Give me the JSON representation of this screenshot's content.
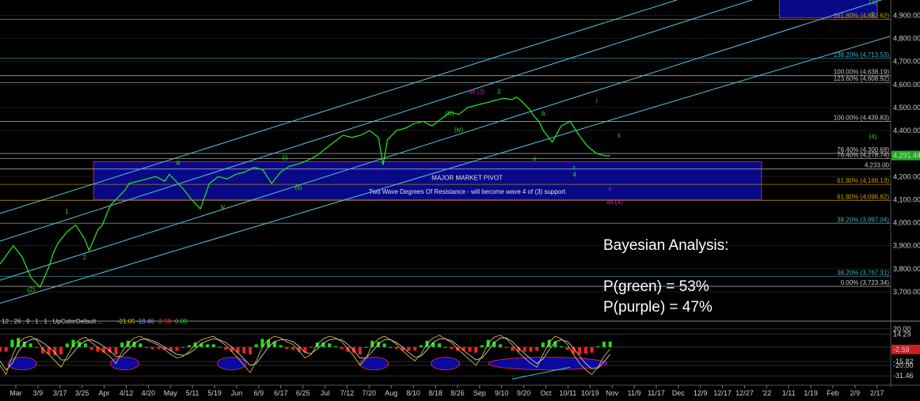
{
  "chart_data": {
    "type": "line",
    "price_axis": {
      "ylim": [
        3600,
        4960
      ],
      "ticks": [
        "4,900.00",
        "4,800.00",
        "4,700.00",
        "4,600.00",
        "4,500.00",
        "4,400.00",
        "4,300.00",
        "4,200.00",
        "4,100.00",
        "4,000.00",
        "3,900.00",
        "3,800.00",
        "3,700.00"
      ],
      "tick_values": [
        4900,
        4800,
        4700,
        4600,
        4500,
        4400,
        4300,
        4200,
        4100,
        4000,
        3900,
        3800,
        3700
      ]
    },
    "x_ticks": [
      "Mar",
      "3/9",
      "3/17",
      "3/25",
      "Apr",
      "4/12",
      "4/20",
      "May",
      "5/11",
      "5/19",
      "Jun",
      "6/9",
      "6/17",
      "6/25",
      "Jul",
      "7/12",
      "7/20",
      "Aug",
      "8/10",
      "8/18",
      "8/26",
      "Sep",
      "9/10",
      "9/20",
      "Oct",
      "10/11",
      "10/19",
      "Nov",
      "11/9",
      "11/17",
      "Dec",
      "12/9",
      "12/17",
      "12/27",
      "'22",
      "1/11",
      "1/19",
      "Feb",
      "2/9",
      "2/17"
    ],
    "price_series": {
      "color": "#22dd22",
      "x": [
        0,
        3,
        5,
        7,
        9,
        11,
        12,
        13,
        15,
        17,
        19,
        20,
        22,
        23,
        24,
        25,
        27,
        28,
        29,
        31,
        33,
        35,
        37,
        38,
        39,
        41,
        43,
        45,
        47,
        49,
        51,
        53,
        55,
        57,
        59,
        61,
        63,
        65,
        67,
        69,
        71,
        73,
        75,
        77,
        79,
        81,
        83,
        85,
        86,
        87,
        89,
        91,
        93,
        95,
        97,
        99,
        101,
        103,
        105,
        107,
        109,
        111,
        113,
        115,
        116,
        117,
        118,
        119,
        120,
        121,
        122,
        124,
        126,
        128,
        130,
        132,
        134,
        136,
        137
      ],
      "y": [
        3820,
        3900,
        3850,
        3760,
        3720,
        3810,
        3870,
        3910,
        3960,
        3990,
        3930,
        3880,
        3970,
        3990,
        4040,
        4080,
        4120,
        4140,
        4170,
        4180,
        4190,
        4200,
        4180,
        4210,
        4190,
        4150,
        4100,
        4060,
        4170,
        4200,
        4190,
        4210,
        4220,
        4240,
        4230,
        4170,
        4220,
        4245,
        4255,
        4270,
        4290,
        4320,
        4350,
        4380,
        4370,
        4380,
        4400,
        4370,
        4250,
        4360,
        4400,
        4410,
        4430,
        4440,
        4420,
        4450,
        4480,
        4470,
        4500,
        4510,
        4520,
        4530,
        4540,
        4535,
        4545,
        4530,
        4510,
        4490,
        4460,
        4440,
        4400,
        4350,
        4420,
        4440,
        4380,
        4330,
        4300,
        4290,
        4291
      ]
    },
    "last_price": "4,291.44",
    "price_levels": [
      {
        "label": "161.80% (4,882.62)",
        "value": 4882.62,
        "color": "#c8a000"
      },
      {
        "label": "138.20% (4,713.53)",
        "value": 4713.53,
        "color": "#3fb0c8"
      },
      {
        "label": "100.00% (4,638.19)",
        "value": 4638.19,
        "color": "#c8c8c8"
      },
      {
        "label": "123.60% (4,608.92)",
        "value": 4608.92,
        "color": "#c8c8c8"
      },
      {
        "label": "100.00% (4,439.83)",
        "value": 4439.83,
        "color": "#c8c8c8"
      },
      {
        "label": "76.40% (4,300.68)",
        "value": 4300.68,
        "color": "#c8c8c8"
      },
      {
        "label": "76.40% (4,278.74)",
        "value": 4278.74,
        "color": "#c8c8c8"
      },
      {
        "label": "4,233.00",
        "value": 4233.0,
        "color": "#c8c8c8"
      },
      {
        "label": "61.80% (4,166.13)",
        "value": 4166.13,
        "color": "#c8a000"
      },
      {
        "label": "61.80% (4,096.82)",
        "value": 4096.82,
        "color": "#c8a000"
      },
      {
        "label": "38.20% (3,997.04)",
        "value": 3997.04,
        "color": "#3fb0c8"
      },
      {
        "label": "38.20% (3,767.31)",
        "value": 3767.31,
        "color": "#3fb0c8"
      },
      {
        "label": "0.00% (3,723.34)",
        "value": 3723.34,
        "color": "#c8c8c8"
      }
    ],
    "channels": [
      {
        "x0": 0,
        "y0": 3750,
        "x1": 200,
        "y1": 4980,
        "color": "#55c8e0"
      },
      {
        "x0": 0,
        "y0": 3920,
        "x1": 200,
        "y1": 5160,
        "color": "#55c8e0"
      },
      {
        "x0": 0,
        "y0": 4040,
        "x1": 200,
        "y1": 5260,
        "color": "#55c8e0"
      },
      {
        "x0": 0,
        "y0": 3650,
        "x1": 200,
        "y1": 4810,
        "color": "#55c8e0"
      }
    ],
    "zones": [
      {
        "x0": 21,
        "x1": 171,
        "y0": 4100,
        "y1": 4265,
        "title": "MAJOR MARKET PIVOT",
        "subtitle": "Two Wave Degrees Of Resistance - will become wave 4 of (3) support"
      },
      {
        "x0": 175,
        "x1": 197,
        "y0": 4890,
        "y1": 4980,
        "title": "",
        "subtitle": ""
      }
    ],
    "wave_labels": [
      {
        "text": "(2)",
        "x": 7,
        "y": 3700,
        "color": "#22dd22"
      },
      {
        "text": "1",
        "x": 15,
        "y": 4040,
        "color": "#22dd22"
      },
      {
        "text": "2",
        "x": 19,
        "y": 3840,
        "color": "#22dd22"
      },
      {
        "text": "iii",
        "x": 40,
        "y": 4250,
        "color": "#22dd22"
      },
      {
        "text": "iv",
        "x": 50,
        "y": 4060,
        "color": "#22dd22"
      },
      {
        "text": "(i)",
        "x": 64,
        "y": 4275,
        "color": "#22dd22"
      },
      {
        "text": "(ii)",
        "x": 67,
        "y": 4145,
        "color": "#22dd22"
      },
      {
        "text": "(iii)",
        "x": 101,
        "y": 4465,
        "color": "#22dd22"
      },
      {
        "text": "(iv)",
        "x": 103,
        "y": 4395,
        "color": "#22dd22"
      },
      {
        "text": "3",
        "x": 112,
        "y": 4560,
        "color": "#22dd22"
      },
      {
        "text": "b",
        "x": 122,
        "y": 4465,
        "color": "#22dd22"
      },
      {
        "text": "a",
        "x": 120,
        "y": 4270,
        "color": "#22dd22"
      },
      {
        "text": "c",
        "x": 129,
        "y": 4230,
        "color": "#22dd22"
      },
      {
        "text": "4",
        "x": 129,
        "y": 4200,
        "color": "#22dd22"
      },
      {
        "text": "i",
        "x": 134,
        "y": 4520,
        "color": "#22dd22"
      },
      {
        "text": "ii",
        "x": 139,
        "y": 4370,
        "color": "#22dd22"
      },
      {
        "text": "(4)",
        "x": 196,
        "y": 4365,
        "color": "#22dd22"
      },
      {
        "text": "(3)",
        "x": 196,
        "y": 4950,
        "color": "#22dd22"
      },
      {
        "text": "5",
        "x": 196,
        "y": 4895,
        "color": "#22dd22"
      },
      {
        "text": "alt (3)",
        "x": 107,
        "y": 4560,
        "color": "#c020c0"
      },
      {
        "text": "alt (4)",
        "x": 138,
        "y": 4080,
        "color": "#c020c0"
      },
      {
        "text": "c",
        "x": 137,
        "y": 4140,
        "color": "#c020c0"
      }
    ],
    "indicator": {
      "legend": [
        "12 , 26 , 9 , 1 , 1 , UpColorDefault ...",
        "-21.05",
        "-18.46",
        "-2.59",
        "0.00"
      ],
      "legend_colors": [
        "#c8c8c8",
        "#c8c000",
        "#8aa0ff",
        "#ff3030",
        "#22dd22"
      ],
      "ylim": [
        -40,
        25
      ],
      "ticks": [
        "20.00",
        "14.29",
        "-15.82",
        "-20.00",
        "-31.46"
      ],
      "tick_values": [
        20,
        14.29,
        -15.82,
        -20,
        -31.46
      ],
      "last_value": "-2.59",
      "line": [
        -20,
        -30,
        -10,
        5,
        10,
        12,
        8,
        -2,
        -8,
        -15,
        -22,
        -10,
        2,
        8,
        11,
        5,
        0,
        -5,
        -10,
        -18,
        -5,
        4,
        10,
        12,
        8,
        5,
        2,
        -3,
        -8,
        -12,
        -10,
        -5,
        3,
        8,
        10,
        12,
        7,
        2,
        -5,
        -12,
        -20,
        -28,
        -15,
        0,
        8,
        12,
        10,
        6,
        3,
        -4,
        -12,
        -8,
        3,
        9,
        12,
        10,
        6,
        -2,
        -10,
        -20,
        -12,
        2,
        9,
        12,
        8,
        3,
        -4,
        -10,
        -15,
        -8,
        4,
        10,
        13,
        9,
        5,
        -2,
        -8,
        -14,
        -20,
        -10,
        4,
        11,
        13,
        9,
        2,
        -6,
        -12,
        -18,
        -22,
        -8,
        5,
        12,
        9,
        3,
        -8,
        -18,
        -25,
        -30,
        -22,
        -10,
        -2
      ],
      "signal": [
        -15,
        -25,
        -18,
        -5,
        4,
        8,
        9,
        5,
        0,
        -6,
        -14,
        -14,
        -6,
        2,
        7,
        8,
        5,
        1,
        -4,
        -10,
        -10,
        -3,
        4,
        8,
        9,
        7,
        4,
        0,
        -4,
        -8,
        -9,
        -7,
        -2,
        4,
        7,
        9,
        8,
        5,
        0,
        -6,
        -13,
        -20,
        -18,
        -9,
        0,
        6,
        8,
        8,
        6,
        1,
        -6,
        -7,
        -2,
        4,
        8,
        9,
        8,
        3,
        -4,
        -12,
        -12,
        -5,
        3,
        8,
        8,
        5,
        0,
        -6,
        -11,
        -10,
        -3,
        5,
        9,
        9,
        7,
        2,
        -4,
        -9,
        -14,
        -12,
        -4,
        5,
        10,
        10,
        6,
        -1,
        -7,
        -13,
        -18,
        -13,
        -3,
        6,
        8,
        6,
        -1,
        -10,
        -18,
        -24,
        -23,
        -16,
        -8
      ],
      "histogram_color_pos": "#22dd22",
      "histogram_color_neg": "#ff2020",
      "ellipses_x": [
        5,
        28,
        52,
        84,
        100,
        123
      ]
    }
  },
  "overlay": {
    "line1": "Bayesian Analysis:",
    "line2": "P(green) = 53%",
    "line3": "P(purple) = 47%"
  }
}
